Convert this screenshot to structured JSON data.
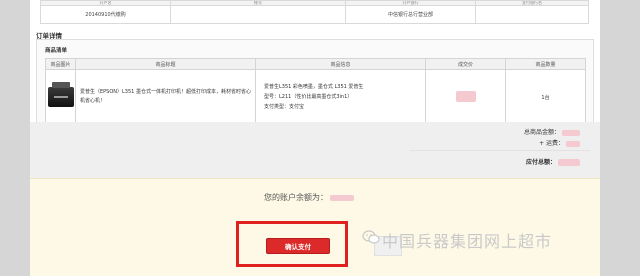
{
  "bank_table": {
    "headers": [
      "开户名",
      "帐号",
      "开户银行",
      "支付银行名"
    ],
    "row": {
      "account_name": "20140910代缴购",
      "bank": "中信银行总行营业部"
    }
  },
  "order_details": {
    "title": "订单详情",
    "list_title": "商品清单",
    "columns": [
      "商品图片",
      "商品标题",
      "商品信息",
      "成交价",
      "商品数量"
    ],
    "item": {
      "title": "爱普生（EPSON）L351 墨仓式一体机打印机！超低打印成本，耗材省时省心机省心机！",
      "info_line1": "爱普生L351 彩色喷墨，墨仓式 L351 爱普生",
      "info_line2": "型号：L211（性价比最高墨仓式3in1）",
      "info_line3": "支付类型：支付宝",
      "quantity": "1台"
    }
  },
  "totals": {
    "goods_total_label": "总商品金额：",
    "shipping_label": "+ 运费：",
    "payable_label": "应付总额："
  },
  "payment": {
    "balance_label": "您的账户余额为：",
    "confirm_label": "确认支付"
  },
  "watermark": "中国兵器集团网上超市",
  "colors": {
    "accent": "#dc2a2a",
    "highlight": "#e02020",
    "pay_area_bg": "#fdf9e6"
  }
}
